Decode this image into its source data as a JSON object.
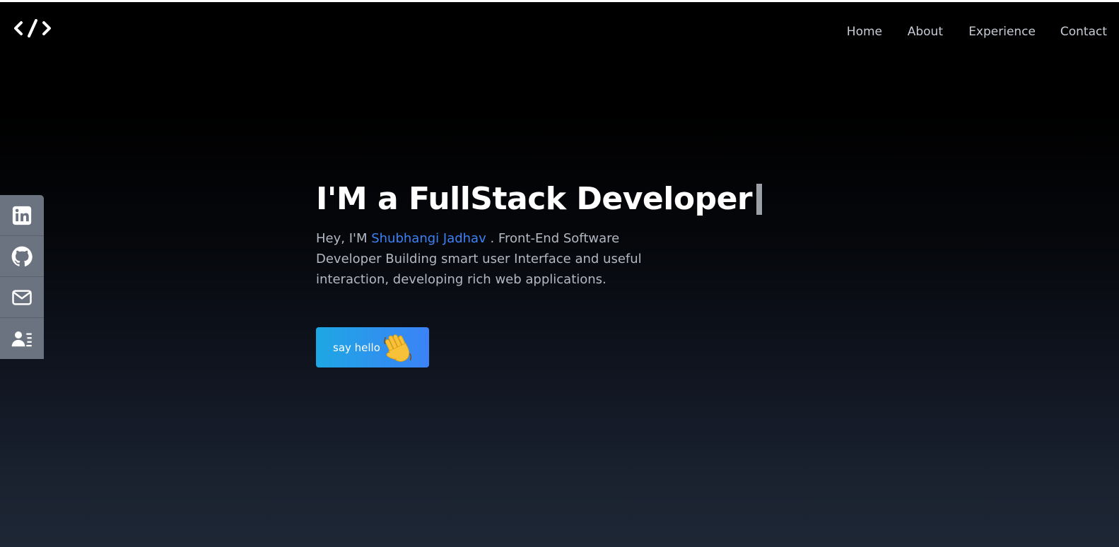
{
  "logo": {
    "icon": "code-brackets-icon",
    "alt": "</>"
  },
  "nav": {
    "items": [
      {
        "label": "Home"
      },
      {
        "label": "About"
      },
      {
        "label": "Experience"
      },
      {
        "label": "Contact"
      }
    ]
  },
  "social": {
    "items": [
      {
        "icon": "linkedin-icon"
      },
      {
        "icon": "github-icon"
      },
      {
        "icon": "mail-icon"
      },
      {
        "icon": "contact-card-icon"
      }
    ]
  },
  "hero": {
    "title": "I'M a FullStack Developer",
    "intro_prefix": "Hey, I'M ",
    "name": "Shubhangi Jadhav",
    "intro_suffix": " . Front-End Software Developer Building smart user Interface and useful interaction, developing rich web applications."
  },
  "cta": {
    "label": "say hello",
    "icon": "waving-hand-icon"
  },
  "colors": {
    "accent": "#3b82f6",
    "button_start": "#1ea7e4",
    "button_end": "#3b82f6",
    "sidebar": "#6b7280"
  }
}
